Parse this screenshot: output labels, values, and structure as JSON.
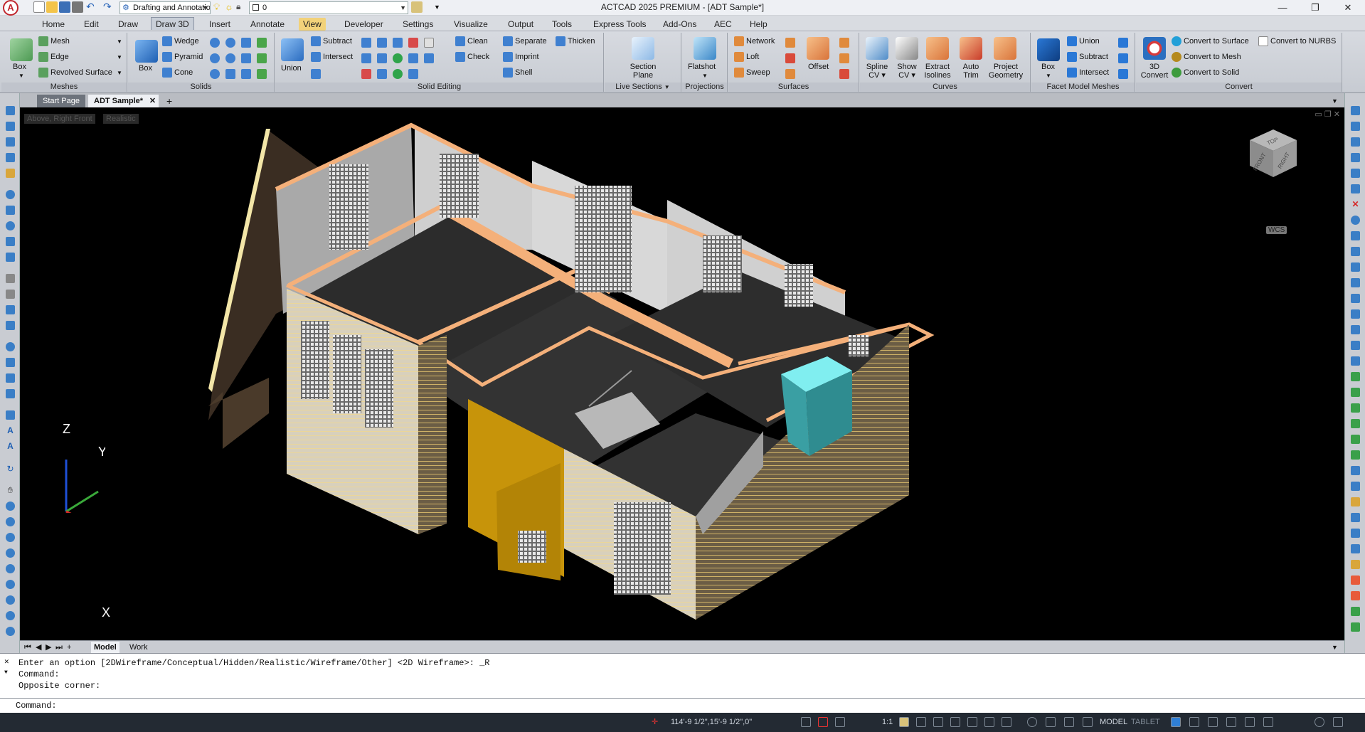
{
  "window": {
    "title": "ACTCAD 2025 PREMIUM - [ADT Sample*]"
  },
  "quick_access": {
    "workspace": "Drafting and Annotation",
    "layer": "0"
  },
  "menu_tabs": [
    "Home",
    "Edit",
    "Draw",
    "Draw 3D",
    "Insert",
    "Annotate",
    "View",
    "Developer",
    "Settings",
    "Visualize",
    "Output",
    "Tools",
    "Express Tools",
    "Add-Ons",
    "AEC",
    "Help"
  ],
  "active_tab": "Draw 3D",
  "ribbon": {
    "meshes": {
      "title": "Meshes",
      "box": "Box",
      "items": [
        "Mesh",
        "Edge",
        "Revolved Surface"
      ]
    },
    "solids": {
      "title": "Solids",
      "box": "Box",
      "items": [
        "Wedge",
        "Pyramid",
        "Cone"
      ]
    },
    "solid_editing": {
      "title": "Solid Editing",
      "union": "Union",
      "items": [
        "Subtract",
        "Intersect"
      ],
      "items2": [
        "Clean",
        "Check"
      ],
      "items3": [
        "Separate",
        "Imprint",
        "Shell"
      ],
      "thicken": "Thicken"
    },
    "live_sections": {
      "title": "Live Sections",
      "button": "Section Plane"
    },
    "projections": {
      "title": "Projections",
      "button": "Flatshot"
    },
    "surfaces": {
      "title": "Surfaces",
      "items": [
        "Network",
        "Loft",
        "Sweep"
      ],
      "offset": "Offset"
    },
    "curves": {
      "title": "Curves",
      "buttons": [
        "Spline CV",
        "Show CV",
        "Extract Isolines",
        "Auto Trim",
        "Project Geometry"
      ]
    },
    "facet": {
      "title": "Facet Model Meshes",
      "box": "Box",
      "items": [
        "Union",
        "Subtract",
        "Intersect"
      ]
    },
    "convert": {
      "title": "Convert",
      "big": "3D Convert",
      "items": [
        "Convert to Surface",
        "Convert to Mesh",
        "Convert to Solid"
      ],
      "nurbs": "Convert to NURBS"
    }
  },
  "doc_tabs": [
    "Start Page",
    "ADT Sample*"
  ],
  "viewport": {
    "view_label": "Above, Right Front",
    "style_label": "Realistic",
    "cube_top": "TOP",
    "cube_front": "FRONT",
    "cube_right": "RIGHT",
    "wcs": "WCS",
    "axis_z": "Z",
    "axis_y": "Y",
    "axis_x": "X"
  },
  "layout_tabs": [
    "Model",
    "Work"
  ],
  "command": {
    "history": [
      "Enter an option [2DWireframe/Conceptual/Hidden/Realistic/Wireframe/Other] <2D Wireframe>: _R",
      "Command:",
      "Opposite corner:"
    ],
    "prompt": "Command:"
  },
  "status": {
    "coords": "114'-9 1/2\",15'-9 1/2\",0\"",
    "scale": "1:1",
    "model": "MODEL",
    "tablet": "TABLET"
  },
  "colors": {
    "accent": "#f2d27a",
    "viewport": "#000000",
    "wall": "#d8d8d8",
    "trim": "#f5b27a",
    "floor": "#2d2d2d",
    "brick": "#7a6a4d",
    "glass": "#7fe6ea",
    "gold": "#c8940a"
  }
}
